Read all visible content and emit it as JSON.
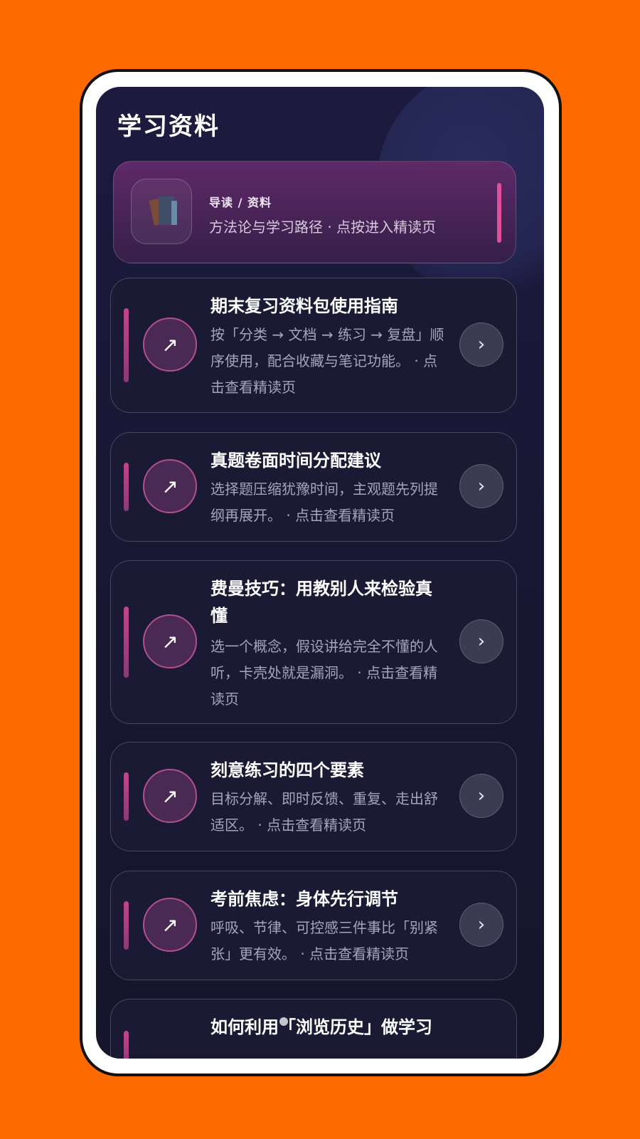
{
  "page": {
    "title": "学习资料"
  },
  "hero": {
    "kicker": "导读 / 资料",
    "subtitle": "方法论与学习路径 · 点按进入精读页",
    "icon": "books-icon"
  },
  "cards": [
    {
      "title": "期末复习资料包使用指南",
      "desc": "按「分类 → 文档 → 练习 → 复盘」顺序使用，配合收藏与笔记功能。 · 点击查看精读页",
      "icon": "arrow-up-right-icon"
    },
    {
      "title": "真题卷面时间分配建议",
      "desc": "选择题压缩犹豫时间，主观题先列提纲再展开。 · 点击查看精读页",
      "icon": "arrow-up-right-icon"
    },
    {
      "title": "费曼技巧：用教别人来检验真懂",
      "desc": "选一个概念，假设讲给完全不懂的人听，卡壳处就是漏洞。 · 点击查看精读页",
      "icon": "arrow-up-right-icon"
    },
    {
      "title": "刻意练习的四个要素",
      "desc": "目标分解、即时反馈、重复、走出舒适区。 · 点击查看精读页",
      "icon": "arrow-up-right-icon"
    },
    {
      "title": "考前焦虑：身体先行调节",
      "desc": "呼吸、节律、可控感三件事比「别紧张」更有效。 · 点击查看精读页",
      "icon": "arrow-up-right-icon"
    },
    {
      "title": "如何利用「浏览历史」做学习",
      "desc": "",
      "icon": "arrow-up-right-icon"
    }
  ],
  "glyphs": {
    "arrow": "↗",
    "chevron": "›"
  },
  "colors": {
    "background": "#FF6A00",
    "accent": "#E0509A",
    "screen": "#1C1A3E"
  }
}
